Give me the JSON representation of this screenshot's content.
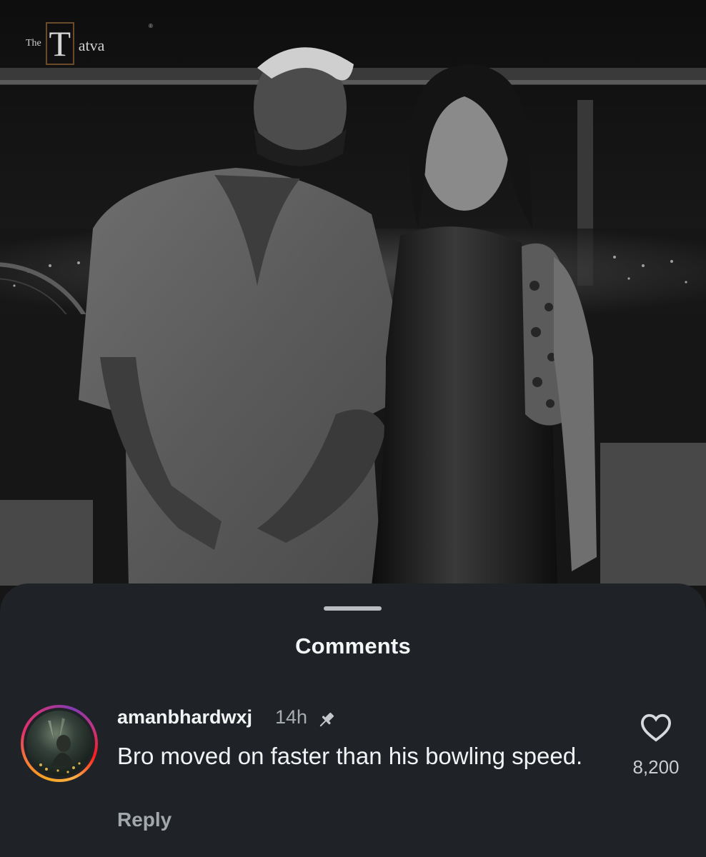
{
  "watermark": {
    "prefix": "The",
    "initial": "T",
    "rest": "atva",
    "registered": "®"
  },
  "sheet": {
    "title": "Comments"
  },
  "comment": {
    "username": "amanbhardwxj",
    "time": "14h",
    "text": "Bro moved on faster than his bowling speed.",
    "reply_label": "Reply",
    "likes": "8,200",
    "pinned": true,
    "avatar_ring_colors": [
      "#f5a623",
      "#e1306c",
      "#833ab4"
    ]
  },
  "icons": {
    "pin": "pin-icon",
    "heart": "heart-icon"
  },
  "colors": {
    "sheet_background": "#1f2226",
    "primary_text": "#f2f3f4",
    "secondary_text": "#a8adb2"
  }
}
